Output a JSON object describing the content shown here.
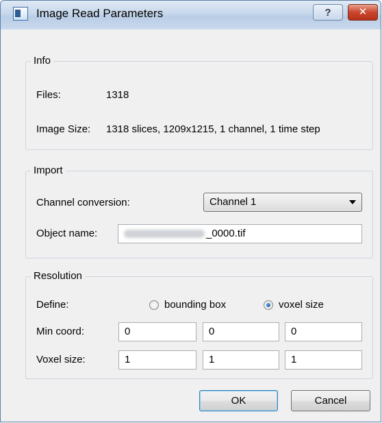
{
  "window": {
    "title": "Image Read Parameters",
    "help_label": "?",
    "close_label": "✕"
  },
  "info": {
    "group_title": "Info",
    "files_label": "Files:",
    "files_value": "1318",
    "image_size_label": "Image Size:",
    "image_size_value": "1318 slices, 1209x1215, 1 channel, 1 time step"
  },
  "import": {
    "group_title": "Import",
    "channel_conversion_label": "Channel conversion:",
    "channel_conversion_value": "Channel 1",
    "object_name_label": "Object name:",
    "object_name_value_suffix": "_0000.tif"
  },
  "resolution": {
    "group_title": "Resolution",
    "define_label": "Define:",
    "option_bounding_box": "bounding box",
    "option_voxel_size": "voxel size",
    "selected_option": "voxel size",
    "min_coord_label": "Min coord:",
    "min_coord_values": [
      "0",
      "0",
      "0"
    ],
    "voxel_size_label": "Voxel size:",
    "voxel_size_values": [
      "1",
      "1",
      "1"
    ]
  },
  "buttons": {
    "ok": "OK",
    "cancel": "Cancel"
  }
}
